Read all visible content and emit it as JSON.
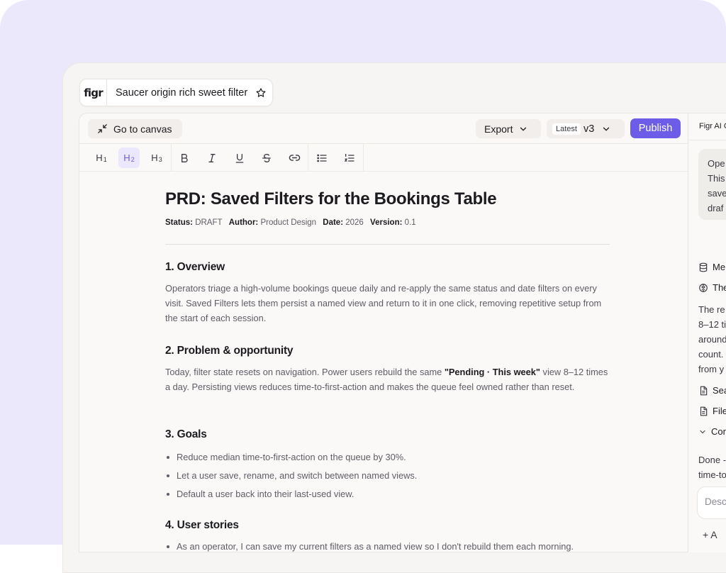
{
  "app": {
    "logo_text": "figr",
    "doc_title": "Saucer origin rich sweet filter"
  },
  "topbar": {
    "go_to_canvas_label": "Go to canvas",
    "export_label": "Export",
    "version_tag": "Latest",
    "version_value": "v3",
    "publish_label": "Publish"
  },
  "formatbar": {
    "h1_label": "H",
    "h1_sub": "1",
    "h2_label": "H",
    "h2_sub": "2",
    "h3_label": "H",
    "h3_sub": "3",
    "active_heading": "h2"
  },
  "document": {
    "title": "PRD: Saved Filters for the Bookings Table",
    "meta": {
      "status_key": "Status:",
      "status_val": "DRAFT",
      "author_key": "Author:",
      "author_val": "Product Design",
      "date_key": "Date:",
      "date_val": "2026",
      "version_key": "Version:",
      "version_val": "0.1"
    },
    "sections": [
      {
        "heading": "1. Overview",
        "body": "Operators triage a high-volume bookings queue daily and re-apply the same status and date filters on every visit. Saved Filters lets them persist a named view and return to it in one click, removing repetitive setup from the start of each session."
      },
      {
        "heading": "2. Problem & opportunity",
        "body_pre": "Today, filter state resets on navigation. Power users rebuild the same ",
        "body_bold": "\"Pending · This week\"",
        "body_post": " view 8–12 times a day. Persisting views reduces time-to-first-action and makes the queue feel owned rather than reset."
      },
      {
        "heading": "3. Goals",
        "bullets": [
          "Reduce median time-to-first-action on the queue by 30%.",
          "Let a user save, rename, and switch between named views.",
          "Default a user back into their last-used view."
        ]
      },
      {
        "heading": "4. User stories",
        "partial": "As an operator, I can save my current filters as a named view so I don't rebuild them each morning."
      }
    ]
  },
  "ai_panel": {
    "header": "Figr AI C",
    "bubble_lines": [
      "Ope",
      "This",
      "save",
      "draf"
    ],
    "rows": [
      {
        "icon": "database-icon",
        "label": "Me"
      },
      {
        "icon": "brain-icon",
        "label": "The"
      }
    ],
    "reply_lines": [
      "The re",
      "8–12 ti",
      "around",
      "count.",
      "from y"
    ],
    "files": [
      {
        "icon": "document-icon",
        "label": "Sea"
      },
      {
        "icon": "document-icon",
        "label": "File"
      }
    ],
    "collapse_label": "Cor",
    "done_lines": [
      "Done -",
      "time-to"
    ],
    "input_placeholder": "Desc",
    "add_label": "+ A"
  },
  "colors": {
    "accent": "#6c5ce7",
    "backdrop": "#ebe8fc",
    "frame": "#f7f5f3"
  }
}
